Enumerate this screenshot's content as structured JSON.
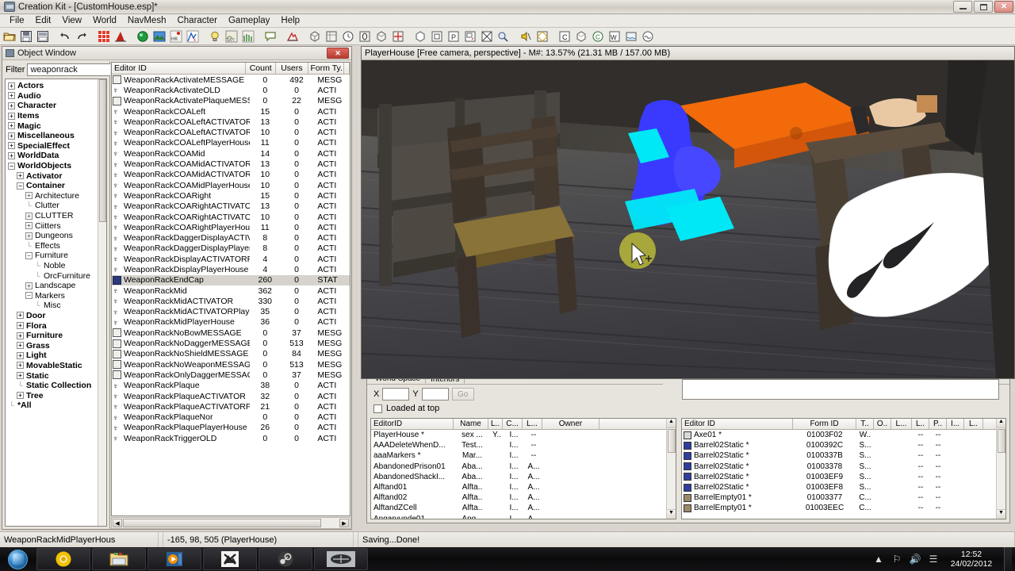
{
  "window": {
    "title": "Creation Kit - [CustomHouse.esp]*",
    "icon": "creation-kit-icon",
    "buttons": {
      "minimize": "—",
      "maximize": "❐",
      "close": "✕"
    }
  },
  "menu": {
    "items": [
      "File",
      "Edit",
      "View",
      "World",
      "NavMesh",
      "Character",
      "Gameplay",
      "Help"
    ]
  },
  "toolbar": {
    "groups": [
      [
        "open-folder-icon",
        "save-icon",
        "save-as-icon"
      ],
      [
        "undo-icon",
        "redo-icon"
      ],
      [
        "cell-view-icon",
        "render-window-icon"
      ],
      [
        "preview-window-icon",
        "landscape-editor-icon",
        "havok-icon",
        "animation-icon"
      ],
      [
        "light-icon",
        "sky-icon",
        "grass-icon"
      ],
      [
        "dialogue-icon"
      ],
      [
        "heightmap-icon"
      ],
      [
        "object-window-icon",
        "object-palette-icon",
        "clock-icon",
        "zero-icon",
        "box-icon",
        "crosshair-icon"
      ],
      [
        "cube-icon",
        "frame-icon",
        "portal-icon",
        "room-marker-icon",
        "no-marker-icon",
        "snap-icon"
      ],
      [
        "audio-icon",
        "navmesh-icon"
      ],
      [
        "cell-icon",
        "multibound-icon",
        "copy-icon",
        "world-icon",
        "water-icon",
        "weather-icon"
      ]
    ]
  },
  "object_window": {
    "title": "Object Window",
    "icon": "object-window-icon",
    "close_label": "✕",
    "filter": {
      "label": "Filter",
      "value": "weaponrack",
      "placeholder": ""
    },
    "tree": [
      {
        "label": "Actors",
        "indent": 0,
        "state": "collapsed",
        "bold": true
      },
      {
        "label": "Audio",
        "indent": 0,
        "state": "collapsed",
        "bold": true
      },
      {
        "label": "Character",
        "indent": 0,
        "state": "collapsed",
        "bold": true
      },
      {
        "label": "Items",
        "indent": 0,
        "state": "collapsed",
        "bold": true
      },
      {
        "label": "Magic",
        "indent": 0,
        "state": "collapsed",
        "bold": true
      },
      {
        "label": "Miscellaneous",
        "indent": 0,
        "state": "collapsed",
        "bold": true
      },
      {
        "label": "SpecialEffect",
        "indent": 0,
        "state": "collapsed",
        "bold": true
      },
      {
        "label": "WorldData",
        "indent": 0,
        "state": "collapsed",
        "bold": true
      },
      {
        "label": "WorldObjects",
        "indent": 0,
        "state": "expanded",
        "bold": true
      },
      {
        "label": "Activator",
        "indent": 1,
        "state": "collapsed",
        "bold": true
      },
      {
        "label": "Container",
        "indent": 1,
        "state": "expanded",
        "bold": true
      },
      {
        "label": "Architecture",
        "indent": 2,
        "state": "collapsed",
        "bold": false
      },
      {
        "label": "Clutter",
        "indent": 2,
        "state": "leaf",
        "bold": false
      },
      {
        "label": "CLUTTER",
        "indent": 2,
        "state": "collapsed",
        "bold": false
      },
      {
        "label": "Ciitters",
        "indent": 2,
        "state": "collapsed",
        "bold": false
      },
      {
        "label": "Dungeons",
        "indent": 2,
        "state": "collapsed",
        "bold": false
      },
      {
        "label": "Effects",
        "indent": 2,
        "state": "leaf",
        "bold": false
      },
      {
        "label": "Furniture",
        "indent": 2,
        "state": "expanded",
        "bold": false
      },
      {
        "label": "Noble",
        "indent": 3,
        "state": "leaf",
        "bold": false
      },
      {
        "label": "OrcFurniture",
        "indent": 3,
        "state": "leaf",
        "bold": false
      },
      {
        "label": "Landscape",
        "indent": 2,
        "state": "collapsed",
        "bold": false
      },
      {
        "label": "Markers",
        "indent": 2,
        "state": "expanded",
        "bold": false
      },
      {
        "label": "Misc",
        "indent": 3,
        "state": "leaf",
        "bold": false
      },
      {
        "label": "Door",
        "indent": 1,
        "state": "collapsed",
        "bold": true
      },
      {
        "label": "Flora",
        "indent": 1,
        "state": "collapsed",
        "bold": true
      },
      {
        "label": "Furniture",
        "indent": 1,
        "state": "collapsed",
        "bold": true
      },
      {
        "label": "Grass",
        "indent": 1,
        "state": "collapsed",
        "bold": true
      },
      {
        "label": "Light",
        "indent": 1,
        "state": "collapsed",
        "bold": true
      },
      {
        "label": "MovableStatic",
        "indent": 1,
        "state": "collapsed",
        "bold": true
      },
      {
        "label": "Static",
        "indent": 1,
        "state": "collapsed",
        "bold": true
      },
      {
        "label": "Static Collection",
        "indent": 1,
        "state": "leaf",
        "bold": true
      },
      {
        "label": "Tree",
        "indent": 1,
        "state": "collapsed",
        "bold": true
      },
      {
        "label": "*All",
        "indent": 0,
        "state": "leaf",
        "bold": true
      }
    ],
    "list": {
      "columns": [
        "Editor ID",
        "Count",
        "Users",
        "Form Ty..",
        ""
      ],
      "rows": [
        {
          "icon": "message-icon",
          "editor_id": "WeaponRackActivateMESSAGE",
          "count": "0",
          "users": "492",
          "form_type": "MESG",
          "selected": false
        },
        {
          "icon": "activator-icon",
          "editor_id": "WeaponRackActivateOLD",
          "count": "0",
          "users": "0",
          "form_type": "ACTI",
          "selected": false
        },
        {
          "icon": "message-icon",
          "editor_id": "WeaponRackActivatePlaqueMESSAGE",
          "count": "0",
          "users": "22",
          "form_type": "MESG",
          "selected": false
        },
        {
          "icon": "activator-icon",
          "editor_id": "WeaponRackCOALeft",
          "count": "15",
          "users": "0",
          "form_type": "ACTI",
          "selected": false
        },
        {
          "icon": "activator-icon",
          "editor_id": "WeaponRackCOALeftACTIVATOR",
          "count": "13",
          "users": "0",
          "form_type": "ACTI",
          "selected": false
        },
        {
          "icon": "activator-icon",
          "editor_id": "WeaponRackCOALeftACTIVATORPla...",
          "count": "10",
          "users": "0",
          "form_type": "ACTI",
          "selected": false
        },
        {
          "icon": "activator-icon",
          "editor_id": "WeaponRackCOALeftPlayerHouse",
          "count": "11",
          "users": "0",
          "form_type": "ACTI",
          "selected": false
        },
        {
          "icon": "activator-icon",
          "editor_id": "WeaponRackCOAMid",
          "count": "14",
          "users": "0",
          "form_type": "ACTI",
          "selected": false
        },
        {
          "icon": "activator-icon",
          "editor_id": "WeaponRackCOAMidACTIVATOR",
          "count": "13",
          "users": "0",
          "form_type": "ACTI",
          "selected": false
        },
        {
          "icon": "activator-icon",
          "editor_id": "WeaponRackCOAMidACTIVATORPla...",
          "count": "10",
          "users": "0",
          "form_type": "ACTI",
          "selected": false
        },
        {
          "icon": "activator-icon",
          "editor_id": "WeaponRackCOAMidPlayerHouse",
          "count": "10",
          "users": "0",
          "form_type": "ACTI",
          "selected": false
        },
        {
          "icon": "activator-icon",
          "editor_id": "WeaponRackCOARight",
          "count": "15",
          "users": "0",
          "form_type": "ACTI",
          "selected": false
        },
        {
          "icon": "activator-icon",
          "editor_id": "WeaponRackCOARightACTIVATOR",
          "count": "13",
          "users": "0",
          "form_type": "ACTI",
          "selected": false
        },
        {
          "icon": "activator-icon",
          "editor_id": "WeaponRackCOARightACTIVATORP...",
          "count": "10",
          "users": "0",
          "form_type": "ACTI",
          "selected": false
        },
        {
          "icon": "activator-icon",
          "editor_id": "WeaponRackCOARightPlayerHouse",
          "count": "11",
          "users": "0",
          "form_type": "ACTI",
          "selected": false
        },
        {
          "icon": "activator-icon",
          "editor_id": "WeaponRackDaggerDisplayACTIVAT...",
          "count": "8",
          "users": "0",
          "form_type": "ACTI",
          "selected": false
        },
        {
          "icon": "activator-icon",
          "editor_id": "WeaponRackDaggerDisplayPlayerHo...",
          "count": "8",
          "users": "0",
          "form_type": "ACTI",
          "selected": false
        },
        {
          "icon": "activator-icon",
          "editor_id": "WeaponRackDisplayACTIVATORPlay...",
          "count": "4",
          "users": "0",
          "form_type": "ACTI",
          "selected": false
        },
        {
          "icon": "activator-icon",
          "editor_id": "WeaponRackDisplayPlayerHouse",
          "count": "4",
          "users": "0",
          "form_type": "ACTI",
          "selected": false
        },
        {
          "icon": "static-icon",
          "editor_id": "WeaponRackEndCap",
          "count": "260",
          "users": "0",
          "form_type": "STAT",
          "selected": true
        },
        {
          "icon": "activator-icon",
          "editor_id": "WeaponRackMid",
          "count": "362",
          "users": "0",
          "form_type": "ACTI",
          "selected": false
        },
        {
          "icon": "activator-icon",
          "editor_id": "WeaponRackMidACTIVATOR",
          "count": "330",
          "users": "0",
          "form_type": "ACTI",
          "selected": false
        },
        {
          "icon": "activator-icon",
          "editor_id": "WeaponRackMidACTIVATORPlayerH...",
          "count": "35",
          "users": "0",
          "form_type": "ACTI",
          "selected": false
        },
        {
          "icon": "activator-icon",
          "editor_id": "WeaponRackMidPlayerHouse",
          "count": "36",
          "users": "0",
          "form_type": "ACTI",
          "selected": false
        },
        {
          "icon": "message-icon",
          "editor_id": "WeaponRackNoBowMESSAGE",
          "count": "0",
          "users": "37",
          "form_type": "MESG",
          "selected": false
        },
        {
          "icon": "message-icon",
          "editor_id": "WeaponRackNoDaggerMESSAGE",
          "count": "0",
          "users": "513",
          "form_type": "MESG",
          "selected": false
        },
        {
          "icon": "message-icon",
          "editor_id": "WeaponRackNoShieldMESSAGE",
          "count": "0",
          "users": "84",
          "form_type": "MESG",
          "selected": false
        },
        {
          "icon": "message-icon",
          "editor_id": "WeaponRackNoWeaponMESSAGE",
          "count": "0",
          "users": "513",
          "form_type": "MESG",
          "selected": false
        },
        {
          "icon": "message-icon",
          "editor_id": "WeaponRackOnlyDaggerMESSAGE",
          "count": "0",
          "users": "37",
          "form_type": "MESG",
          "selected": false
        },
        {
          "icon": "activator-icon",
          "editor_id": "WeaponRackPlaque",
          "count": "38",
          "users": "0",
          "form_type": "ACTI",
          "selected": false
        },
        {
          "icon": "activator-icon",
          "editor_id": "WeaponRackPlaqueACTIVATOR",
          "count": "32",
          "users": "0",
          "form_type": "ACTI",
          "selected": false
        },
        {
          "icon": "activator-icon",
          "editor_id": "WeaponRackPlaqueACTIVATORPlay...",
          "count": "21",
          "users": "0",
          "form_type": "ACTI",
          "selected": false
        },
        {
          "icon": "activator-icon",
          "editor_id": "WeaponRackPlaqueNor",
          "count": "0",
          "users": "0",
          "form_type": "ACTI",
          "selected": false
        },
        {
          "icon": "activator-icon",
          "editor_id": "WeaponRackPlaquePlayerHouse",
          "count": "26",
          "users": "0",
          "form_type": "ACTI",
          "selected": false
        },
        {
          "icon": "activator-icon",
          "editor_id": "WeaponRackTriggerOLD",
          "count": "0",
          "users": "0",
          "form_type": "ACTI",
          "selected": false
        }
      ]
    }
  },
  "render_window": {
    "title": "PlayerHouse [Free camera, perspective] - M#: 13.57% (21.31 MB / 157.00 MB)",
    "scene": {
      "description": "3D viewport showing wooden interior with chairs, table and selected white mesh",
      "selection_highlight_color": "#ffffff",
      "marker_colors": [
        "#00e5f0",
        "#3333ff",
        "#ff6a00",
        "#b8b840"
      ]
    }
  },
  "cell_view": {
    "tabs": [
      {
        "label": "World Space",
        "active": false
      },
      {
        "label": "Interiors",
        "active": true
      }
    ],
    "coords": {
      "x_label": "X",
      "x_value": "",
      "y_label": "Y",
      "y_value": "",
      "go_label": "Go"
    },
    "loaded_at_top": {
      "label": "Loaded at top",
      "checked": false
    },
    "cell_list": {
      "columns": [
        "EditorID",
        "Name",
        "L..",
        "C...",
        "L...",
        "Owner",
        ""
      ],
      "rows": [
        {
          "editor_id": "PlayerHouse *",
          "name": "sex ...",
          "l1": "Y..",
          "c": "I...",
          "l2": "--",
          "owner": ""
        },
        {
          "editor_id": "AAADeleteWhenD...",
          "name": "Test...",
          "l1": "",
          "c": "I...",
          "l2": "--",
          "owner": ""
        },
        {
          "editor_id": "aaaMarkers *",
          "name": "Mar...",
          "l1": "",
          "c": "I...",
          "l2": "--",
          "owner": ""
        },
        {
          "editor_id": "AbandonedPrison01",
          "name": "Aba...",
          "l1": "",
          "c": "I...",
          "l2": "A...",
          "owner": ""
        },
        {
          "editor_id": "AbandonedShackI...",
          "name": "Aba...",
          "l1": "",
          "c": "I...",
          "l2": "A...",
          "owner": ""
        },
        {
          "editor_id": "Alftand01",
          "name": "Alfta..",
          "l1": "",
          "c": "I...",
          "l2": "A...",
          "owner": ""
        },
        {
          "editor_id": "Alftand02",
          "name": "Alfta..",
          "l1": "",
          "c": "I...",
          "l2": "A...",
          "owner": ""
        },
        {
          "editor_id": "AlftandZCell",
          "name": "Alfta..",
          "l1": "",
          "c": "I...",
          "l2": "A...",
          "owner": ""
        },
        {
          "editor_id": "Angarvunde01",
          "name": "Ang...",
          "l1": "",
          "c": "I...",
          "l2": "A...",
          "owner": ""
        }
      ]
    },
    "object_list": {
      "columns": [
        "Editor ID",
        "Form ID",
        "T..",
        "O..",
        "L...",
        "L..",
        "P..",
        "I...",
        "L..",
        ""
      ],
      "rows": [
        {
          "icon": "weapon-icon",
          "editor_id": "Axe01 *",
          "form_id": "01003F02",
          "t": "W..",
          "o": "",
          "l1": "",
          "l2": "--",
          "p": "--"
        },
        {
          "icon": "barrel-icon",
          "editor_id": "Barrel02Static *",
          "form_id": "0100392C",
          "t": "S...",
          "o": "",
          "l1": "",
          "l2": "--",
          "p": "--"
        },
        {
          "icon": "barrel-icon",
          "editor_id": "Barrel02Static *",
          "form_id": "0100337B",
          "t": "S...",
          "o": "",
          "l1": "",
          "l2": "--",
          "p": "--"
        },
        {
          "icon": "barrel-icon",
          "editor_id": "Barrel02Static *",
          "form_id": "01003378",
          "t": "S...",
          "o": "",
          "l1": "",
          "l2": "--",
          "p": "--"
        },
        {
          "icon": "barrel-icon",
          "editor_id": "Barrel02Static *",
          "form_id": "01003EF9",
          "t": "S...",
          "o": "",
          "l1": "",
          "l2": "--",
          "p": "--"
        },
        {
          "icon": "barrel-icon",
          "editor_id": "Barrel02Static *",
          "form_id": "01003EF8",
          "t": "S...",
          "o": "",
          "l1": "",
          "l2": "--",
          "p": "--"
        },
        {
          "icon": "crate-icon",
          "editor_id": "BarrelEmpty01 *",
          "form_id": "01003377",
          "t": "C...",
          "o": "",
          "l1": "",
          "l2": "--",
          "p": "--"
        },
        {
          "icon": "crate-icon",
          "editor_id": "BarrelEmpty01 *",
          "form_id": "01003EEC",
          "t": "C...",
          "o": "",
          "l1": "",
          "l2": "--",
          "p": "--"
        }
      ]
    }
  },
  "status_bar": {
    "segments": [
      "WeaponRackMidPlayerHous",
      "",
      "-165, 98, 505 (PlayerHouse)",
      "",
      "Saving...Done!"
    ]
  },
  "taskbar": {
    "start_label": "start-orb",
    "items": [
      {
        "name": "chrome-icon"
      },
      {
        "name": "explorer-icon"
      },
      {
        "name": "media-player-icon"
      },
      {
        "name": "creation-kit-icon"
      },
      {
        "name": "steam-icon"
      },
      {
        "name": "skyrim-icon"
      }
    ],
    "tray": {
      "icons": [
        "show-hidden-icon",
        "flag-icon",
        "volume-icon",
        "network-icon"
      ],
      "time": "12:52",
      "date": "24/02/2012"
    }
  }
}
